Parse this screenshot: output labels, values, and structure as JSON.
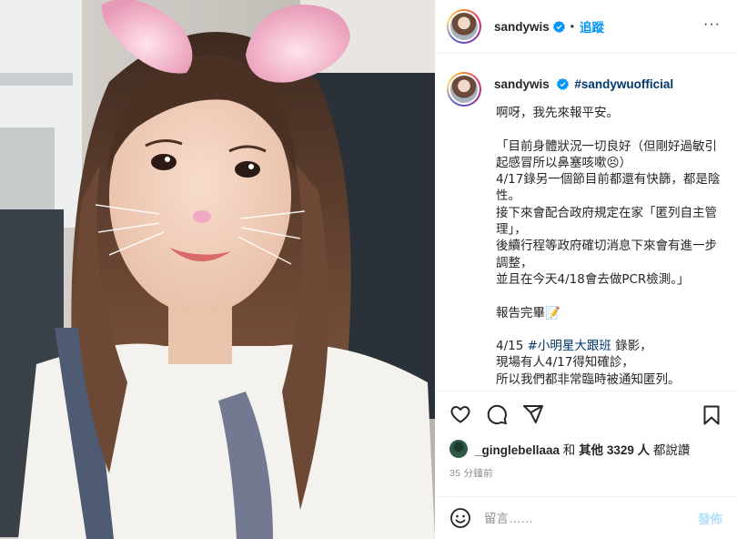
{
  "header": {
    "username": "sandywis",
    "separator": "•",
    "follow_label": "追蹤",
    "more_label": "···"
  },
  "caption": {
    "username": "sandywis",
    "hashtag": "#sandywuofficial",
    "line1": "啊呀，我先來報平安。",
    "body_a": "「目前身體狀況一切良好（但剛好過敏引起感冒所以鼻塞咳嗽😣）\n4/17錄另一個節目前都還有快篩，都是陰性。\n接下來會配合政府規定在家「匿列自主管理」，\n後續行程等政府確切消息下來會有進一步調整，\n並且在今天4/18會去做PCR檢測。」",
    "report": "報告完畢📝",
    "line_pre": "4/15 ",
    "line_tag": "#小明星大跟班",
    "line_post": " 錄影，",
    "body_b": "現場有人4/17得知確診，\n所以我們都非常臨時被通知匿列。"
  },
  "likes": {
    "liker": "_ginglebellaaa",
    "connector": " 和 ",
    "others": "其他 3329 人",
    "suffix": " 都說讚"
  },
  "time": "35 分鐘前",
  "comment": {
    "placeholder": "留言……",
    "post_label": "發佈"
  },
  "colors": {
    "link_blue": "#0095f6",
    "hashtag_blue": "#00376b",
    "post_disabled": "#b2dffc",
    "muted": "#8e8e8e"
  },
  "icons": [
    "verified-badge-icon",
    "heart-icon",
    "comment-icon",
    "share-icon",
    "bookmark-icon",
    "emoji-icon"
  ]
}
